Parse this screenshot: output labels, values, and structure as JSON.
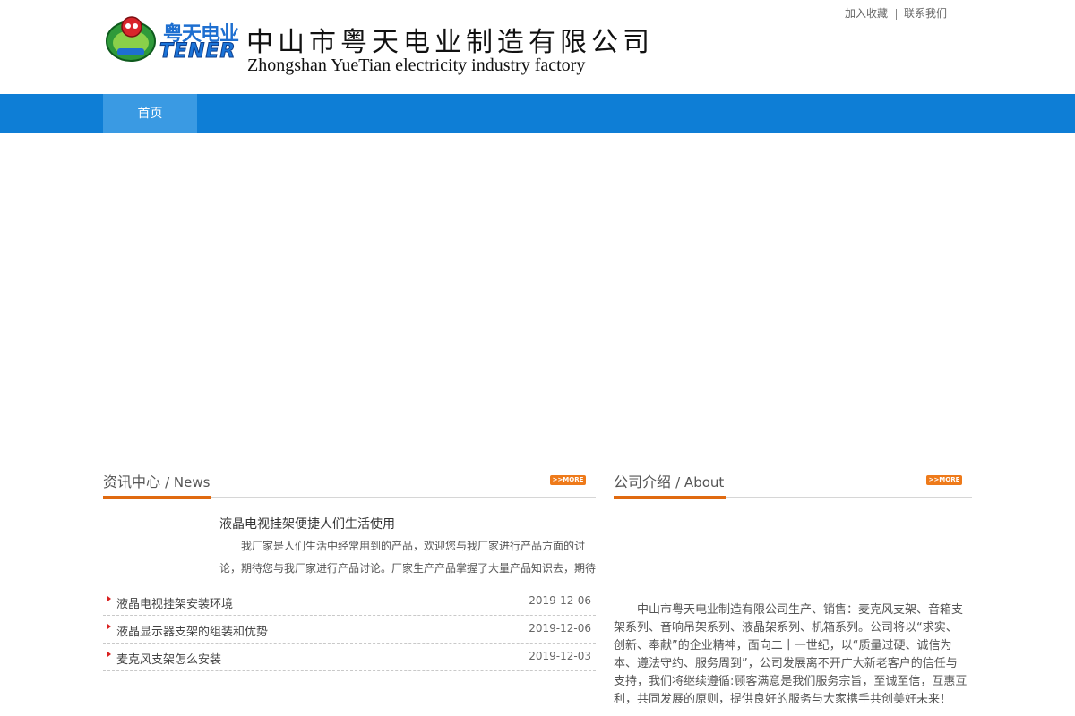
{
  "header": {
    "logo_cn": "粤天电业",
    "logo_en": "TENER",
    "company_cn": "中山市粤天电业制造有限公司",
    "company_en": "Zhongshan YueTian electricity industry factory",
    "top_links": [
      "加入收藏",
      "联系我们"
    ]
  },
  "nav": {
    "items": [
      "首页"
    ]
  },
  "news": {
    "title_cn": "资讯中心",
    "title_en": "/ News",
    "more_label": ">>MORE",
    "feature": {
      "title": "液晶电视挂架便捷人们生活使用",
      "text": "我厂家是人们生活中经常用到的产品，欢迎您与我厂家进行产品方面的讨论，期待您与我厂家进行产品讨论。厂家生产产品掌握了大量产品知识去，期待"
    },
    "items": [
      {
        "title": "液晶电视挂架安装环境",
        "date": "2019-12-06"
      },
      {
        "title": "液晶显示器支架的组装和优势",
        "date": "2019-12-06"
      },
      {
        "title": "麦克风支架怎么安装",
        "date": "2019-12-03"
      }
    ]
  },
  "about": {
    "title_cn": "公司介绍",
    "title_en": "/ About",
    "more_label": ">>MORE",
    "text": "中山市粤天电业制造有限公司生产、销售：麦克风支架、音箱支架系列、音响吊架系列、液晶架系列、机箱系列。公司将以“求实、创新、奉献”的企业精神，面向二十一世纪，以“质量过硬、诚信为本、遵法守约、服务周到”，公司发展离不开广大新老客户的信任与支持，我们将继续遵循:顾客满意是我们服务宗旨，至诚至信，互惠互利，共同发展的原则，提供良好的服务与大家携手共创美好未来！"
  },
  "colors": {
    "nav_blue": "#0e7ed6",
    "nav_active": "#3a9ae3",
    "accent_orange": "#e06a10",
    "bullet_red": "#d9201f"
  }
}
